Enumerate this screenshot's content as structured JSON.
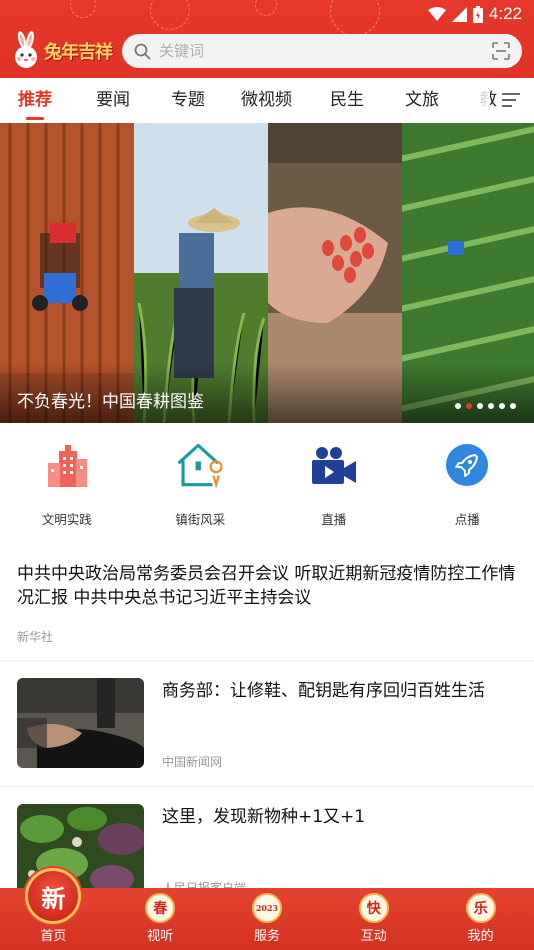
{
  "status_bar": {
    "time": "4:22",
    "icons": [
      "wifi-icon",
      "signal-icon",
      "battery-icon"
    ]
  },
  "header": {
    "logo_text": "兔年吉祥",
    "search_placeholder": "关键词",
    "accent_color": "#e23b2e"
  },
  "tabs": [
    {
      "label": "推荐",
      "active": true
    },
    {
      "label": "要闻",
      "active": false
    },
    {
      "label": "专题",
      "active": false
    },
    {
      "label": "微视频",
      "active": false
    },
    {
      "label": "民生",
      "active": false
    },
    {
      "label": "文旅",
      "active": false
    },
    {
      "label": "教",
      "active": false
    }
  ],
  "banner": {
    "caption": "不负春光！中国春耕图鉴",
    "slide_count": 6,
    "active_slide": 2
  },
  "quick_entries": [
    {
      "label": "文明实践",
      "icon": "buildings-icon"
    },
    {
      "label": "镇街风采",
      "icon": "house-location-icon"
    },
    {
      "label": "直播",
      "icon": "video-camera-icon"
    },
    {
      "label": "点播",
      "icon": "rocket-icon"
    }
  ],
  "feed": {
    "headline": {
      "title": "中共中央政治局常务委员会召开会议 听取近期新冠疫情防控工作情况汇报 中共中央总书记习近平主持会议",
      "source": "新华社"
    },
    "items": [
      {
        "title": "商务部：让修鞋、配钥匙有序回归百姓生活",
        "source": "中国新闻网"
      },
      {
        "title": "这里，发现新物种+1又+1",
        "source": "人民日报客户端"
      }
    ]
  },
  "bottom_nav": [
    {
      "label": "首页",
      "badge": "新",
      "active": true
    },
    {
      "label": "视听",
      "badge": "春"
    },
    {
      "label": "服务",
      "badge": "2023"
    },
    {
      "label": "互动",
      "badge": "快"
    },
    {
      "label": "我的",
      "badge": "乐"
    }
  ]
}
